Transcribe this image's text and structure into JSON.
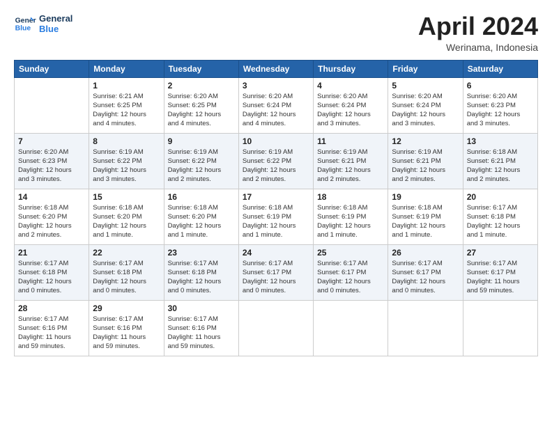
{
  "header": {
    "logo_line1": "General",
    "logo_line2": "Blue",
    "month_title": "April 2024",
    "location": "Werinama, Indonesia"
  },
  "weekdays": [
    "Sunday",
    "Monday",
    "Tuesday",
    "Wednesday",
    "Thursday",
    "Friday",
    "Saturday"
  ],
  "weeks": [
    [
      {
        "day": "",
        "info": ""
      },
      {
        "day": "1",
        "info": "Sunrise: 6:21 AM\nSunset: 6:25 PM\nDaylight: 12 hours\nand 4 minutes."
      },
      {
        "day": "2",
        "info": "Sunrise: 6:20 AM\nSunset: 6:25 PM\nDaylight: 12 hours\nand 4 minutes."
      },
      {
        "day": "3",
        "info": "Sunrise: 6:20 AM\nSunset: 6:24 PM\nDaylight: 12 hours\nand 4 minutes."
      },
      {
        "day": "4",
        "info": "Sunrise: 6:20 AM\nSunset: 6:24 PM\nDaylight: 12 hours\nand 3 minutes."
      },
      {
        "day": "5",
        "info": "Sunrise: 6:20 AM\nSunset: 6:24 PM\nDaylight: 12 hours\nand 3 minutes."
      },
      {
        "day": "6",
        "info": "Sunrise: 6:20 AM\nSunset: 6:23 PM\nDaylight: 12 hours\nand 3 minutes."
      }
    ],
    [
      {
        "day": "7",
        "info": "Sunrise: 6:20 AM\nSunset: 6:23 PM\nDaylight: 12 hours\nand 3 minutes."
      },
      {
        "day": "8",
        "info": "Sunrise: 6:19 AM\nSunset: 6:22 PM\nDaylight: 12 hours\nand 3 minutes."
      },
      {
        "day": "9",
        "info": "Sunrise: 6:19 AM\nSunset: 6:22 PM\nDaylight: 12 hours\nand 2 minutes."
      },
      {
        "day": "10",
        "info": "Sunrise: 6:19 AM\nSunset: 6:22 PM\nDaylight: 12 hours\nand 2 minutes."
      },
      {
        "day": "11",
        "info": "Sunrise: 6:19 AM\nSunset: 6:21 PM\nDaylight: 12 hours\nand 2 minutes."
      },
      {
        "day": "12",
        "info": "Sunrise: 6:19 AM\nSunset: 6:21 PM\nDaylight: 12 hours\nand 2 minutes."
      },
      {
        "day": "13",
        "info": "Sunrise: 6:18 AM\nSunset: 6:21 PM\nDaylight: 12 hours\nand 2 minutes."
      }
    ],
    [
      {
        "day": "14",
        "info": "Sunrise: 6:18 AM\nSunset: 6:20 PM\nDaylight: 12 hours\nand 2 minutes."
      },
      {
        "day": "15",
        "info": "Sunrise: 6:18 AM\nSunset: 6:20 PM\nDaylight: 12 hours\nand 1 minute."
      },
      {
        "day": "16",
        "info": "Sunrise: 6:18 AM\nSunset: 6:20 PM\nDaylight: 12 hours\nand 1 minute."
      },
      {
        "day": "17",
        "info": "Sunrise: 6:18 AM\nSunset: 6:19 PM\nDaylight: 12 hours\nand 1 minute."
      },
      {
        "day": "18",
        "info": "Sunrise: 6:18 AM\nSunset: 6:19 PM\nDaylight: 12 hours\nand 1 minute."
      },
      {
        "day": "19",
        "info": "Sunrise: 6:18 AM\nSunset: 6:19 PM\nDaylight: 12 hours\nand 1 minute."
      },
      {
        "day": "20",
        "info": "Sunrise: 6:17 AM\nSunset: 6:18 PM\nDaylight: 12 hours\nand 1 minute."
      }
    ],
    [
      {
        "day": "21",
        "info": "Sunrise: 6:17 AM\nSunset: 6:18 PM\nDaylight: 12 hours\nand 0 minutes."
      },
      {
        "day": "22",
        "info": "Sunrise: 6:17 AM\nSunset: 6:18 PM\nDaylight: 12 hours\nand 0 minutes."
      },
      {
        "day": "23",
        "info": "Sunrise: 6:17 AM\nSunset: 6:18 PM\nDaylight: 12 hours\nand 0 minutes."
      },
      {
        "day": "24",
        "info": "Sunrise: 6:17 AM\nSunset: 6:17 PM\nDaylight: 12 hours\nand 0 minutes."
      },
      {
        "day": "25",
        "info": "Sunrise: 6:17 AM\nSunset: 6:17 PM\nDaylight: 12 hours\nand 0 minutes."
      },
      {
        "day": "26",
        "info": "Sunrise: 6:17 AM\nSunset: 6:17 PM\nDaylight: 12 hours\nand 0 minutes."
      },
      {
        "day": "27",
        "info": "Sunrise: 6:17 AM\nSunset: 6:17 PM\nDaylight: 11 hours\nand 59 minutes."
      }
    ],
    [
      {
        "day": "28",
        "info": "Sunrise: 6:17 AM\nSunset: 6:16 PM\nDaylight: 11 hours\nand 59 minutes."
      },
      {
        "day": "29",
        "info": "Sunrise: 6:17 AM\nSunset: 6:16 PM\nDaylight: 11 hours\nand 59 minutes."
      },
      {
        "day": "30",
        "info": "Sunrise: 6:17 AM\nSunset: 6:16 PM\nDaylight: 11 hours\nand 59 minutes."
      },
      {
        "day": "",
        "info": ""
      },
      {
        "day": "",
        "info": ""
      },
      {
        "day": "",
        "info": ""
      },
      {
        "day": "",
        "info": ""
      }
    ]
  ]
}
